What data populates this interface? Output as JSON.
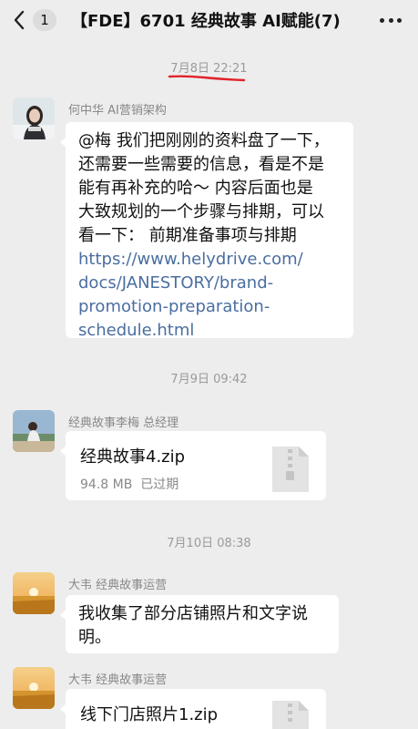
{
  "header": {
    "unread_count": "1",
    "title": "【FDE】6701 经典故事 AI赋能(7)"
  },
  "timestamps": [
    "7月8日 22:21",
    "7月9日 09:42",
    "7月10日 08:38"
  ],
  "messages": [
    {
      "sender": "何中华 AI营销架构",
      "text_lines": [
        "@梅  我们把刚刚的资料盘了一下，",
        "还需要一些需要的信息，看是不是",
        "能有再补充的哈～  内容后面也是",
        "大致规划的一个步骤与排期，可以",
        "看一下：  前期准备事项与排期"
      ],
      "link_lines": [
        "https://www.helydrive.com/",
        "docs/JANESTORY/brand-",
        "promotion-preparation-",
        "schedule.html"
      ]
    },
    {
      "sender": "经典故事李梅 总经理",
      "file_name": "经典故事4.zip",
      "file_size": "94.8 MB",
      "file_status": "已过期"
    },
    {
      "sender": "大韦 经典故事运营",
      "text_lines": [
        "我收集了部分店铺照片和文字说",
        "明。"
      ]
    },
    {
      "sender": "大韦 经典故事运营",
      "file_name": "线下门店照片1.zip"
    }
  ],
  "colors": {
    "background": "#ededed",
    "bubble": "#ffffff",
    "link": "#4a6ea0",
    "annotation_underline": "#e0242a"
  },
  "icons": [
    "back-arrow-icon",
    "more-icon",
    "zip-file-icon"
  ]
}
